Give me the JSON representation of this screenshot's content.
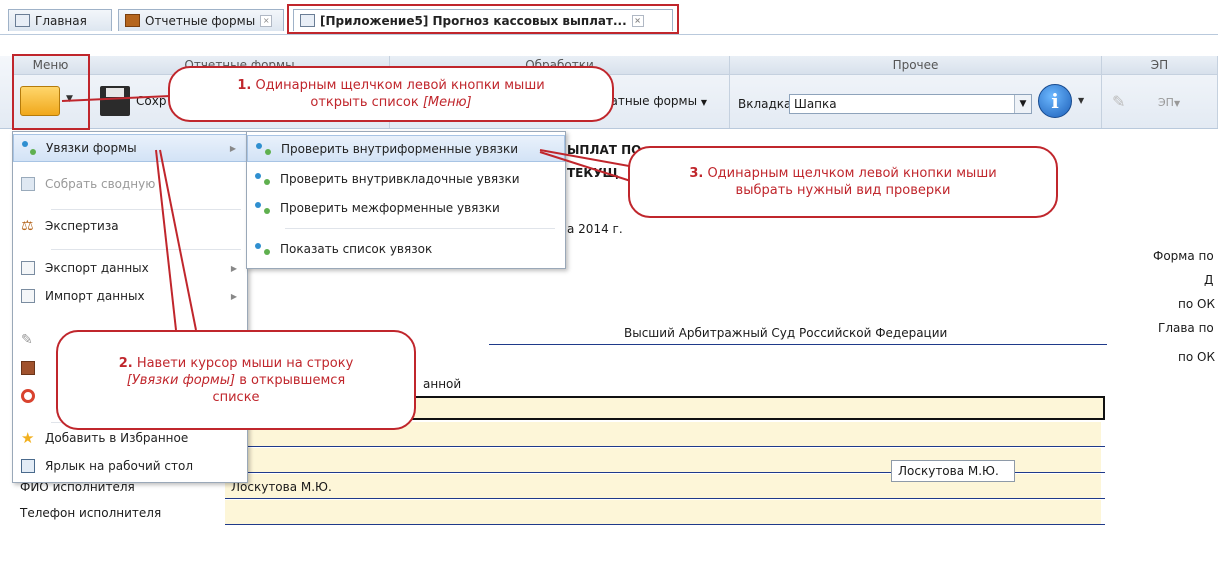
{
  "tabs": [
    {
      "label": "Главная",
      "closable": false
    },
    {
      "label": "Отчетные формы",
      "closable": true
    },
    {
      "label": "[Приложение5] Прогноз кассовых выплат...",
      "closable": true,
      "active": true
    }
  ],
  "ribbon": {
    "groups": {
      "menu": "Меню",
      "report_forms": "Отчетные формы",
      "processing": "Обработки",
      "other": "Прочее",
      "ep": "ЭП"
    },
    "save_label": "Сохр",
    "print_forms_label": "ечатные формы",
    "tab_label": "Вкладка",
    "tab_value": "Шапка",
    "ep_button": "ЭП"
  },
  "menu": {
    "items": [
      {
        "label": "Увязки формы",
        "submenu": true,
        "highlighted": true
      },
      {
        "label": "Собрать сводную",
        "disabled": true
      },
      {
        "label": "Экспертиза"
      },
      {
        "label": "Экспорт данных",
        "submenu": true
      },
      {
        "label": "Импорт данных",
        "submenu": true
      },
      {
        "label": "Добавить в Избранное"
      },
      {
        "label": "Ярлык на рабочий стол"
      }
    ]
  },
  "submenu": {
    "items": [
      {
        "label": "Проверить внутриформенные увязки",
        "highlighted": true
      },
      {
        "label": "Проверить внутривкладочные увязки"
      },
      {
        "label": "Проверить межформенные увязки"
      },
      {
        "label": "Показать список увязок"
      }
    ]
  },
  "document": {
    "title_line1": "ЫПЛАТ ПО",
    "title_line2": "ТЕКУЩ",
    "date_text": "а 2014 г.",
    "right_labels": [
      "Форма по ОК",
      "Д",
      "по ОК",
      "Глава по",
      "по ОК"
    ],
    "org_name": "Высший Арбитражный Суд Российской Федерации",
    "partial_label": "анной",
    "executor_label": "ФИО исполнителя",
    "executor_value": "Лоскутова М.Ю.",
    "phone_label": "Телефон исполнителя",
    "tooltip": "Лоскутова М.Ю."
  },
  "callouts": {
    "c1_num": "1.",
    "c1_text_a": " Одинарным щелчком левой кнопки мыши",
    "c1_text_b": "открыть список ",
    "c1_italic": "[Меню]",
    "c2_num": "2.",
    "c2_text_a": " Навети курсор мыши на строку",
    "c2_italic": "[Увязки формы]",
    "c2_text_b": " в открывшемся",
    "c2_text_c": "списке",
    "c3_num": "3.",
    "c3_text_a": " Одинарным щелчком левой кнопки мыши",
    "c3_text_b": "выбрать нужный вид проверки"
  },
  "colors": {
    "accent_red": "#c0262c",
    "field_yellow": "#fdf6d8",
    "line_blue": "#1f3a8a"
  }
}
